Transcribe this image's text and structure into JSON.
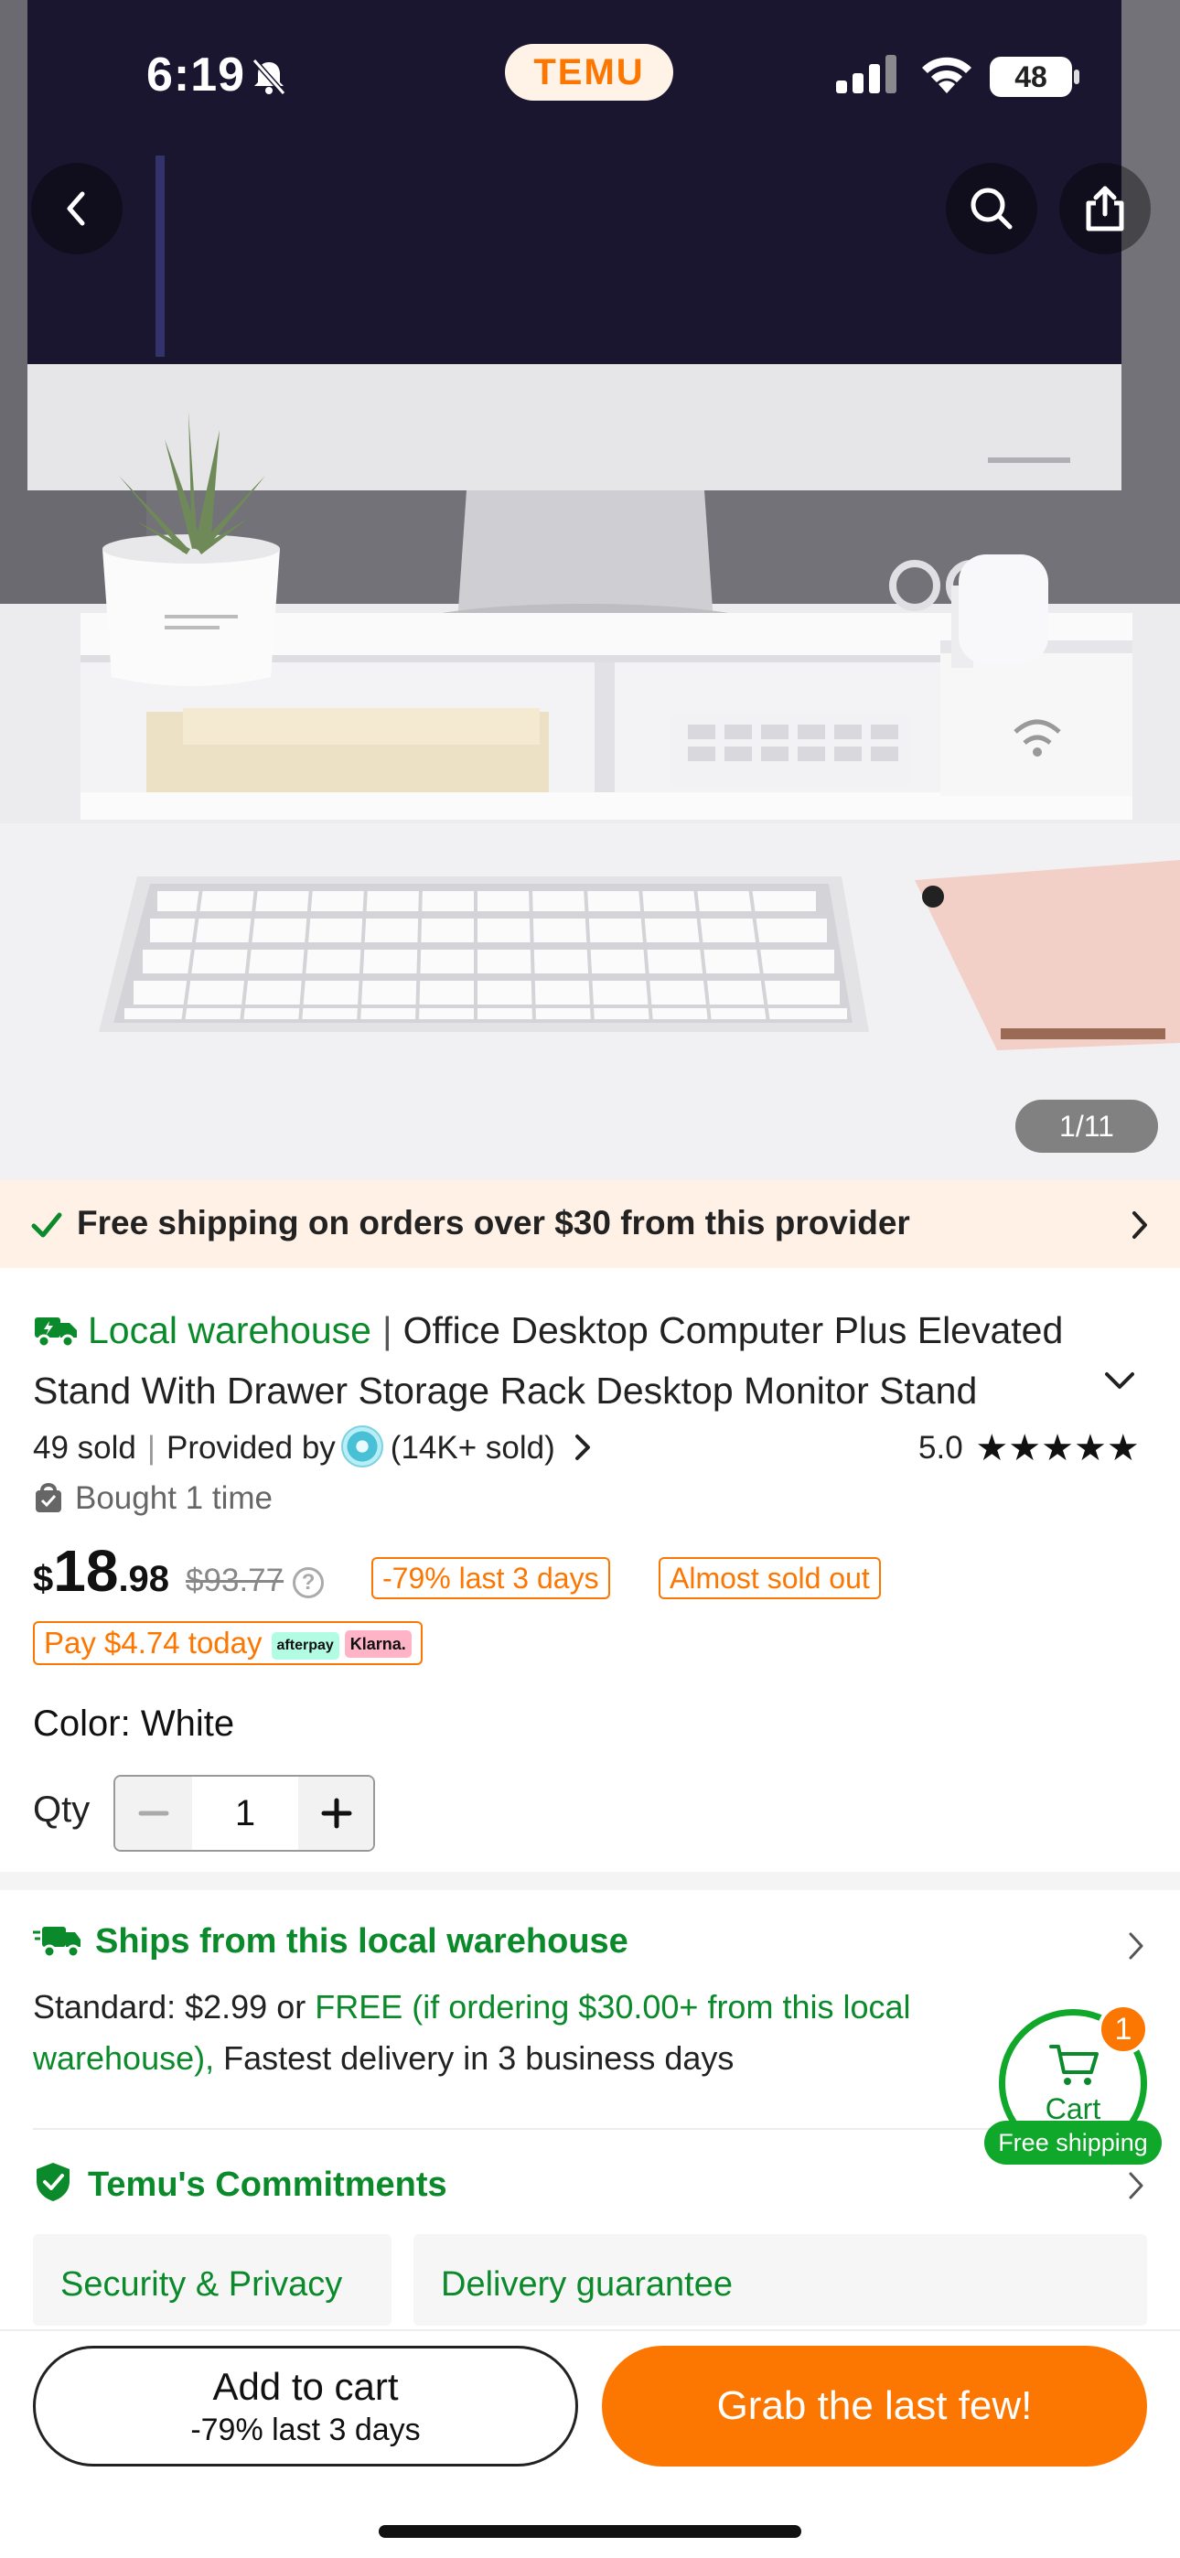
{
  "status_bar": {
    "time": "6:19",
    "app_badge": "TEMU",
    "battery": "48"
  },
  "hero": {
    "image_counter": "1/11"
  },
  "free_shipping_banner": {
    "text": "Free shipping on orders over $30 from this provider"
  },
  "product": {
    "warehouse_label": "Local warehouse",
    "separator": "|",
    "title": "Office Desktop Computer Plus Elevated Stand With Drawer Storage Rack Desktop Monitor Stand Multifunctional Office Supplies",
    "sold": "49 sold",
    "meta_separator": "|",
    "provided_by": "Provided by",
    "store_sold": "(14K+ sold)",
    "rating_value": "5.0",
    "stars": "★★★★★",
    "star_rating": 5,
    "bought": "Bought 1 time",
    "price_currency": "$",
    "price_whole": "18",
    "price_cents": ".98",
    "price_original": "$93.77",
    "discount_tag": "-79% last 3 days",
    "stock_tag": "Almost sold out",
    "pay_today": "Pay $4.74 today",
    "afterpay_label": "afterpay",
    "klarna_label": "Klarna.",
    "color_label": "Color: White",
    "qty_label": "Qty",
    "qty_value": "1"
  },
  "shipping": {
    "heading": "Ships from this local warehouse",
    "standard_prefix": "Standard: $2.99 or ",
    "free_text": "FREE (if ordering $30.00+ from this local warehouse),",
    "delivery_text": " Fastest delivery in 3 business days"
  },
  "commitments": {
    "heading": "Temu's Commitments",
    "chips": [
      "Security & Privacy",
      "Delivery guarantee"
    ]
  },
  "floating_cart": {
    "label": "Cart",
    "badge": "1",
    "pill": "Free shipping"
  },
  "bottom_bar": {
    "add_to_cart": "Add to cart",
    "add_to_cart_sub": "-79% last 3 days",
    "grab": "Grab the last few!"
  },
  "colors": {
    "brand_orange": "#fb7701",
    "green": "#0a8a2a",
    "banner_bg": "#fff1e6"
  }
}
